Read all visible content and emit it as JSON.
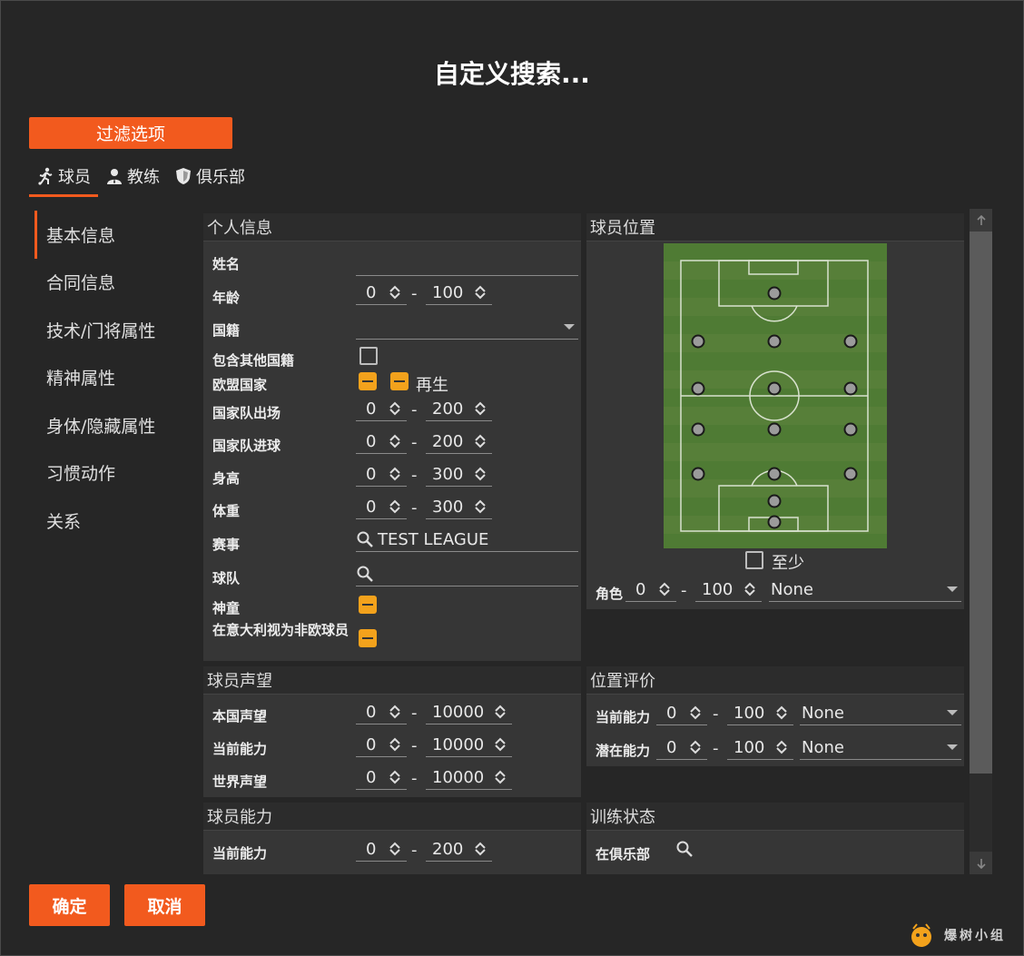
{
  "dialog": {
    "title": "自定义搜索..."
  },
  "filter_button": "过滤选项",
  "tabs": [
    {
      "label": "球员",
      "icon": "runner-icon",
      "active": true
    },
    {
      "label": "教练",
      "icon": "coach-icon",
      "active": false
    },
    {
      "label": "俱乐部",
      "icon": "shield-icon",
      "active": false
    }
  ],
  "sidebar": {
    "items": [
      {
        "label": "基本信息",
        "active": true
      },
      {
        "label": "合同信息"
      },
      {
        "label": "技术/门将属性"
      },
      {
        "label": "精神属性"
      },
      {
        "label": "身体/隐藏属性"
      },
      {
        "label": "习惯动作"
      },
      {
        "label": "关系"
      }
    ]
  },
  "personal": {
    "title": "个人信息",
    "name_label": "姓名",
    "name_value": "",
    "age_label": "年龄",
    "age_min": "0",
    "age_max": "100",
    "nationality_label": "国籍",
    "nationality_value": "",
    "include_other_label": "包含其他国籍",
    "eu_label": "欧盟国家",
    "reborn_label": "再生",
    "caps_label": "国家队出场",
    "caps_min": "0",
    "caps_max": "200",
    "goals_label": "国家队进球",
    "goals_min": "0",
    "goals_max": "200",
    "height_label": "身高",
    "height_min": "0",
    "height_max": "300",
    "weight_label": "体重",
    "weight_min": "0",
    "weight_max": "300",
    "competition_label": "赛事",
    "competition_value": "TEST LEAGUE",
    "team_label": "球队",
    "team_value": "",
    "wonderkid_label": "神童",
    "italy_noneu_label": "在意大利视为非欧球员"
  },
  "position": {
    "title": "球员位置",
    "at_least_label": "至少",
    "role_label": "角色",
    "role_min": "0",
    "role_max": "100",
    "role_value": "None"
  },
  "reputation": {
    "title": "球员声望",
    "home_label": "本国声望",
    "home_min": "0",
    "home_max": "10000",
    "current_label": "当前能力",
    "current_min": "0",
    "current_max": "10000",
    "world_label": "世界声望",
    "world_min": "0",
    "world_max": "10000"
  },
  "rating": {
    "title": "位置评价",
    "ca_label": "当前能力",
    "ca_min": "0",
    "ca_max": "100",
    "ca_value": "None",
    "pa_label": "潜在能力",
    "pa_min": "0",
    "pa_max": "100",
    "pa_value": "None"
  },
  "ability": {
    "title": "球员能力",
    "ca_label": "当前能力",
    "ca_min": "0",
    "ca_max": "200"
  },
  "training": {
    "title": "训练状态",
    "club_label": "在俱乐部",
    "club_value": ""
  },
  "buttons": {
    "ok": "确定",
    "cancel": "取消"
  },
  "watermark": "爆树小组",
  "colors": {
    "accent": "#f25a1e",
    "checkbox": "#f3a21c",
    "pitch": "#4f7b34"
  }
}
